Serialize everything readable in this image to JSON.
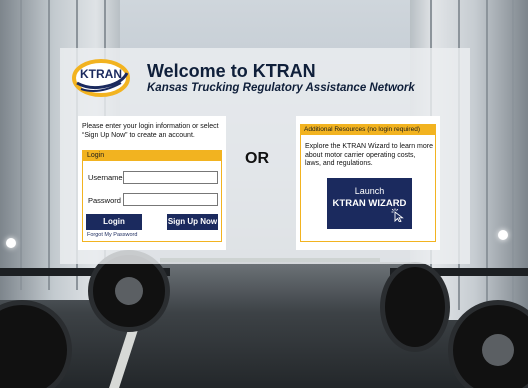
{
  "header": {
    "title": "Welcome to KTRAN",
    "subtitle": "Kansas Trucking Regulatory Assistance Network"
  },
  "logo": {
    "text": "KTRAN",
    "icon": "ktran-logo"
  },
  "login": {
    "intro": "Please enter your login information or select “Sign Up Now” to create an account.",
    "section_title": "Login",
    "username_label": "Username",
    "username_value": "",
    "password_label": "Password",
    "password_value": "",
    "login_button": "Login",
    "signup_button": "Sign Up Now",
    "forgot_link": "Forgot My Password"
  },
  "separator": {
    "or_text": "OR"
  },
  "resources": {
    "section_title": "Additional Resources (no login required)",
    "description": "Explore the KTRAN Wizard to learn more about motor carrier operating costs, laws, and regulations.",
    "wizard_line1": "Launch",
    "wizard_line2": "KTRAN WIZARD",
    "wizard_icon": "cursor-click-icon"
  },
  "colors": {
    "navy": "#1b2a5e",
    "gold": "#f2b320"
  }
}
